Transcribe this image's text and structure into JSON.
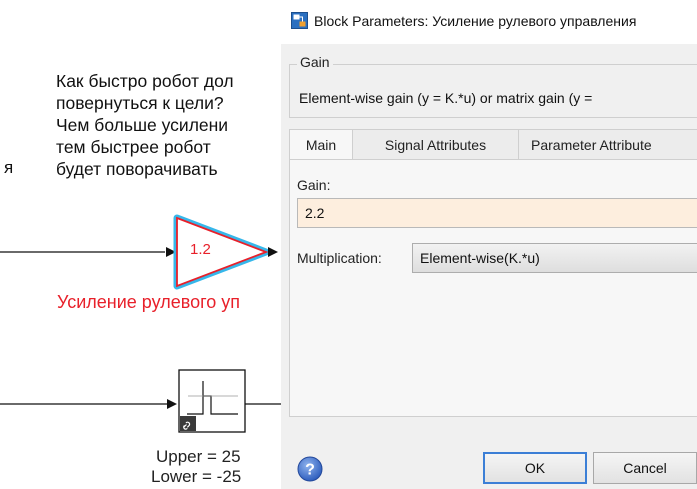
{
  "model": {
    "annotation_lines": [
      "Как быстро робот дол",
      "повернуться к цели?",
      "Чем больше усилени",
      "тем быстрее робот",
      "будет поворачивать"
    ],
    "edge_char": "я",
    "gain_block": {
      "value": "1.2",
      "label": "Усиление рулевого уп"
    },
    "saturation_block": {
      "upper_label": "Upper = 25",
      "lower_label": "Lower = -25"
    },
    "colors": {
      "gain_label": "#e8202a",
      "selection_glow": "#36b7ea"
    }
  },
  "dialog": {
    "title": "Block Parameters: Усиление рулевого управления",
    "title_icon": "simulink-block-icon",
    "group": {
      "label": "Gain",
      "description": "Element-wise gain (y = K.*u) or matrix gain (y = "
    },
    "tabs": [
      {
        "label": "Main",
        "active": true
      },
      {
        "label": "Signal Attributes",
        "active": false
      },
      {
        "label": "Parameter Attribute",
        "active": false
      }
    ],
    "gain_field": {
      "label": "Gain:",
      "value": "2.2"
    },
    "multiplication": {
      "label": "Multiplication:",
      "selected": "Element-wise(K.*u)"
    },
    "buttons": {
      "help_icon": "help-icon",
      "ok": "OK",
      "cancel": "Cancel"
    }
  }
}
